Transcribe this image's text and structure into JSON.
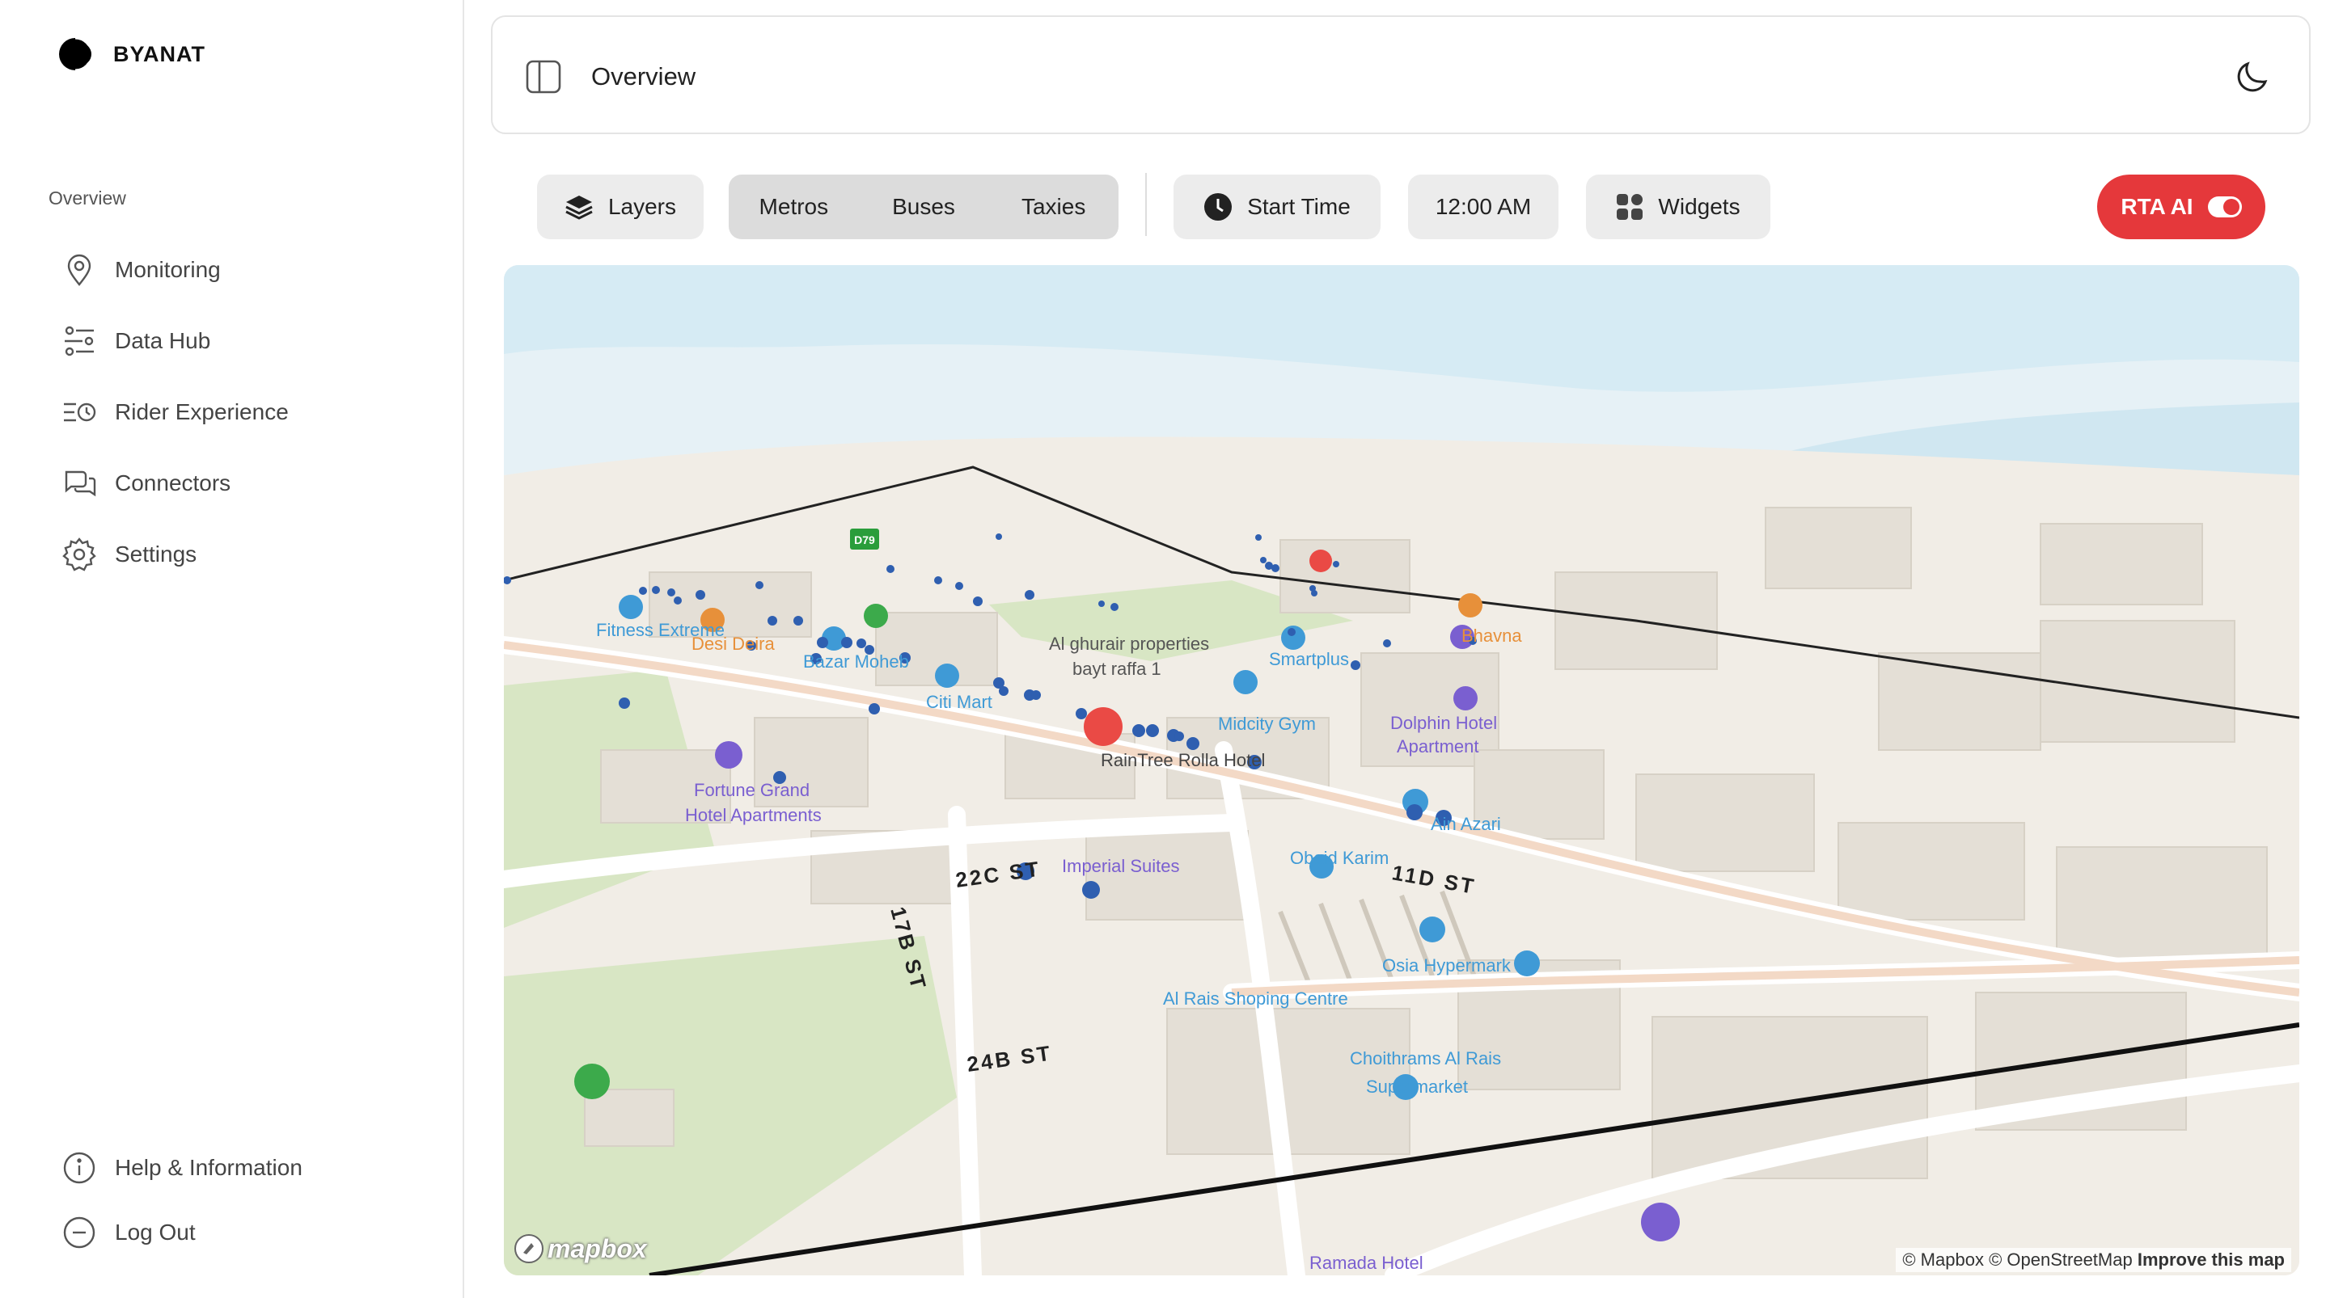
{
  "brand": {
    "name": "BYANAT"
  },
  "sidebar": {
    "section_label": "Overview",
    "items": [
      {
        "label": "Monitoring",
        "icon": "map-pin-icon"
      },
      {
        "label": "Data Hub",
        "icon": "sliders-icon"
      },
      {
        "label": "Rider Experience",
        "icon": "list-clock-icon"
      },
      {
        "label": "Connectors",
        "icon": "chat-bubbles-icon"
      },
      {
        "label": "Settings",
        "icon": "gear-icon"
      }
    ],
    "bottom_items": [
      {
        "label": "Help & Information",
        "icon": "info-icon"
      },
      {
        "label": "Log Out",
        "icon": "minus-circle-icon"
      }
    ]
  },
  "header": {
    "title": "Overview"
  },
  "toolbar": {
    "layers_label": "Layers",
    "modes": [
      "Metros",
      "Buses",
      "Taxies"
    ],
    "start_time_label": "Start Time",
    "time_value": "12:00 AM",
    "widgets_label": "Widgets",
    "ai_label": "RTA AI"
  },
  "map": {
    "colors": {
      "bus_stop": "#2f5fb0",
      "alert": "#ea4a45",
      "poi_blue": "#3f9ad6",
      "poi_orange": "#e7903a",
      "poi_purple": "#7a5fd0",
      "park": "#d8e6c4",
      "water": "#d6ebf4"
    },
    "places": [
      "Fitness Extreme",
      "Desi Deira",
      "Bazar Moheb",
      "Citi Mart",
      "Al ghurair properties",
      "bayt raffa 1",
      "Smartplus",
      "Bhavna",
      "Midcity Gym",
      "Dolphin Hotel",
      "Apartment",
      "RainTree Rolla Hotel",
      "Fortune Grand",
      "Hotel Apartments",
      "Imperial Suites",
      "Obaid Karim",
      "Ain Azari",
      "Osia Hypermark",
      "Al Rais Shoping Centre",
      "Choithrams Al Rais",
      "Supermarket",
      "Ramada Hotel"
    ],
    "streets": [
      "22C ST",
      "24B ST",
      "17B ST",
      "11D ST"
    ],
    "metro_badge": "D79",
    "attribution": {
      "mapbox": "© Mapbox",
      "osm": "© OpenStreetMap",
      "improve": "Improve this map"
    },
    "logo_text": "mapbox"
  }
}
